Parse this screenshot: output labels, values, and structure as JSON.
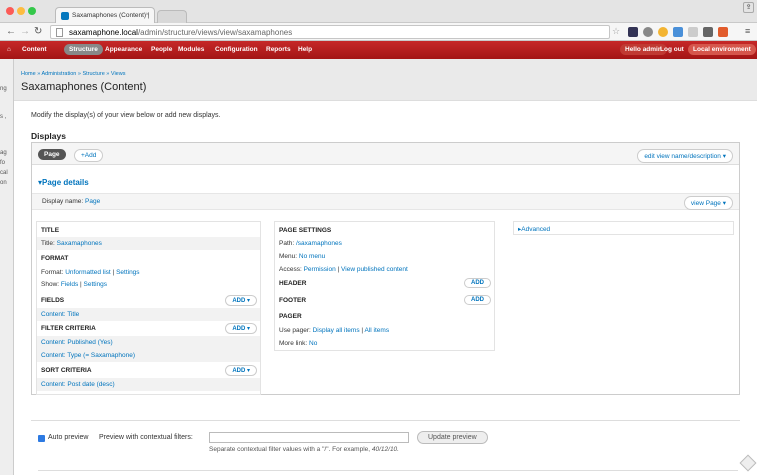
{
  "browser": {
    "tab_title": "Saxamaphones (Content) |",
    "url_host": "saxamaphone.local",
    "url_path": "/admin/structure/views/view/saxamaphones"
  },
  "toolbar": {
    "home_icon": "home-icon",
    "items": [
      "Content",
      "Structure",
      "Appearance",
      "People",
      "Modules",
      "Configuration",
      "Reports",
      "Help"
    ],
    "active": "Structure",
    "hello": "Hello admin",
    "logout": "Log out",
    "env": "Local environment"
  },
  "left_strip": [
    "ng",
    "s ,",
    "ag",
    "fo",
    "cal",
    "on"
  ],
  "header": {
    "breadcrumb": "Home » Administration » Structure » Views",
    "title": "Saxamaphones (Content)"
  },
  "intro": "Modify the display(s) of your view below or add new displays.",
  "displays": {
    "heading": "Displays",
    "page_tab": "Page",
    "add": "+Add",
    "edit": "edit view name/description"
  },
  "details": {
    "heading": "▾Page details",
    "display_name_label": "Display name:",
    "display_name": "Page",
    "view_page": "view Page"
  },
  "col1": {
    "title_h": "TITLE",
    "title_label": "Title:",
    "title_val": "Saxamaphones",
    "format_h": "FORMAT",
    "format_label": "Format:",
    "format_val": "Unformatted list",
    "format_settings": "Settings",
    "show_label": "Show:",
    "show_val": "Fields",
    "show_settings": "Settings",
    "fields_h": "FIELDS",
    "fields_item": "Content: Title",
    "filter_h": "FILTER CRITERIA",
    "filter_1": "Content: Published (Yes)",
    "filter_2": "Content: Type (= Saxamaphone)",
    "sort_h": "SORT CRITERIA",
    "sort_1": "Content: Post date (desc)",
    "add": "Add"
  },
  "col2": {
    "page_settings_h": "PAGE SETTINGS",
    "path_label": "Path:",
    "path_val": "/saxamaphones",
    "menu_label": "Menu:",
    "menu_val": "No menu",
    "access_label": "Access:",
    "access_val": "Permission",
    "access_link": "View published content",
    "header_h": "HEADER",
    "footer_h": "FOOTER",
    "pager_h": "PAGER",
    "pager_label": "Use pager:",
    "pager_val": "Display all items",
    "pager_link": "All items",
    "more_label": "More link:",
    "more_val": "No",
    "add": "Add"
  },
  "advanced": "▸Advanced",
  "preview": {
    "auto": "Auto preview",
    "label": "Preview with contextual filters:",
    "button": "Update preview",
    "help_a": "Separate contextual filter values with a \"/\". For example,",
    "help_b": "40/12/10."
  },
  "colors": {
    "toolbar": "#a31515",
    "link": "#0074bd"
  }
}
